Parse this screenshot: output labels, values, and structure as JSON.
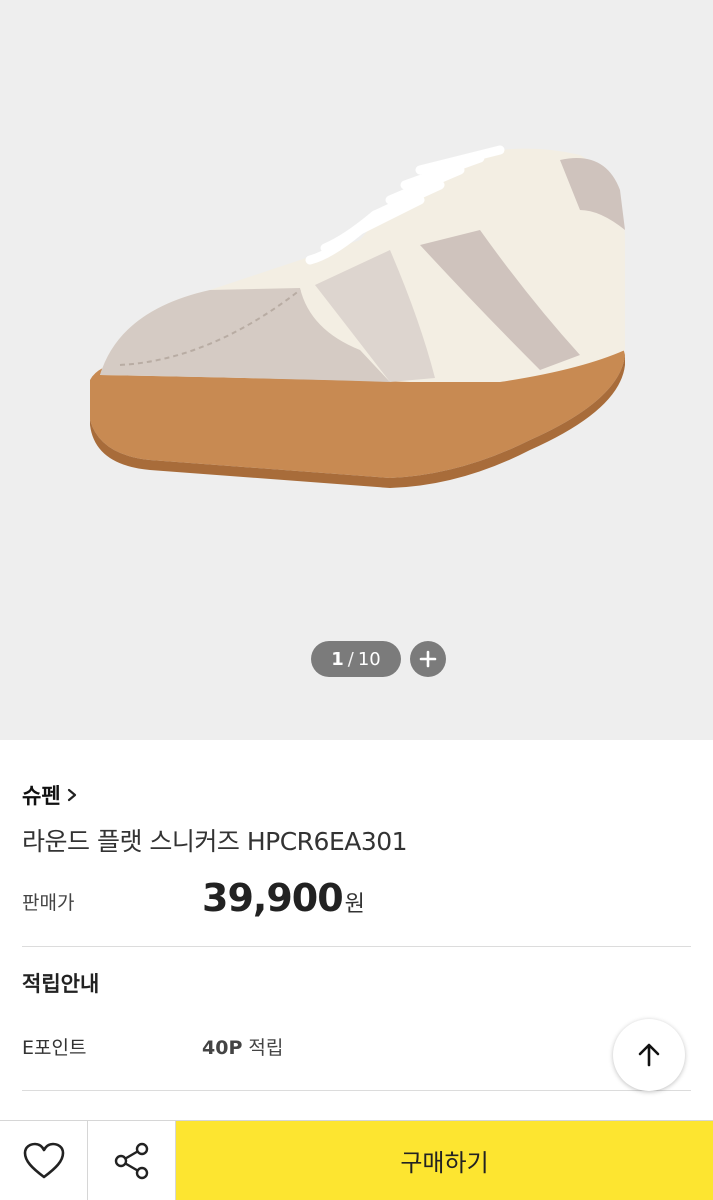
{
  "gallery": {
    "current": "1",
    "separator": "/",
    "total": "10",
    "background": "#eeeeee"
  },
  "product": {
    "brand": "슈펜",
    "name": "라운드 플랫 스니커즈 HPCR6EA301",
    "price_label": "판매가",
    "price_value": "39,900",
    "price_unit": "원"
  },
  "points": {
    "title": "적립안내",
    "label": "E포인트",
    "amount": "40P",
    "suffix": "적립"
  },
  "actions": {
    "buy_label": "구매하기",
    "buy_color": "#fde530",
    "wishlist_icon": "heart-icon",
    "share_icon": "share-icon",
    "scroll_top_icon": "arrow-up-icon",
    "expand_icon": "plus-icon"
  }
}
